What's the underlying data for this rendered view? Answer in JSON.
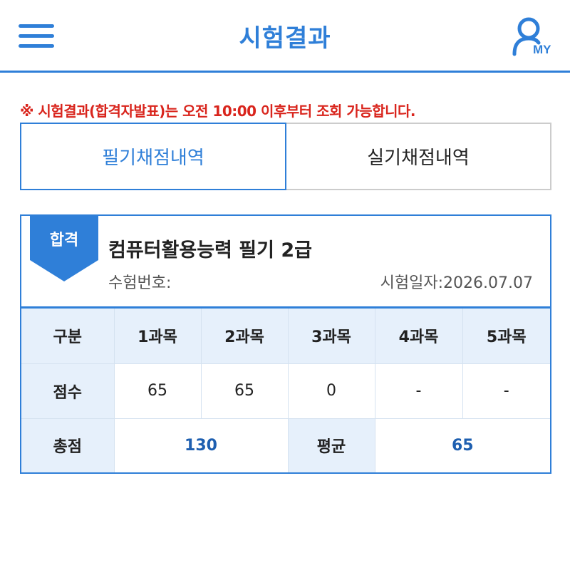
{
  "header": {
    "title": "시험결과",
    "my_label": "MY"
  },
  "notice": {
    "prefix": "※ 시험결과(합격자발표)는 오전 ",
    "time": "10:00",
    "suffix": " 이후부터 조회 가능합니다."
  },
  "tabs": [
    {
      "label": "필기채점내역",
      "active": true
    },
    {
      "label": "실기채점내역",
      "active": false
    }
  ],
  "result": {
    "badge": "합격",
    "exam_name": "컴퓨터활용능력 필기 2급",
    "exam_number_label": "수험번호:",
    "exam_date_label": "시험일자:",
    "exam_date": "2026.07.07"
  },
  "table": {
    "header_label": "구분",
    "subjects": [
      "1과목",
      "2과목",
      "3과목",
      "4과목",
      "5과목"
    ],
    "score_label": "점수",
    "scores": [
      "65",
      "65",
      "0",
      "-",
      "-"
    ],
    "total_label": "총점",
    "total": "130",
    "average_label": "평균",
    "average": "65"
  },
  "colors": {
    "accent": "#2f7fd8",
    "notice_red": "#d9251d",
    "header_cell_bg": "#e6f0fb",
    "total_blue": "#1e5fb0"
  }
}
